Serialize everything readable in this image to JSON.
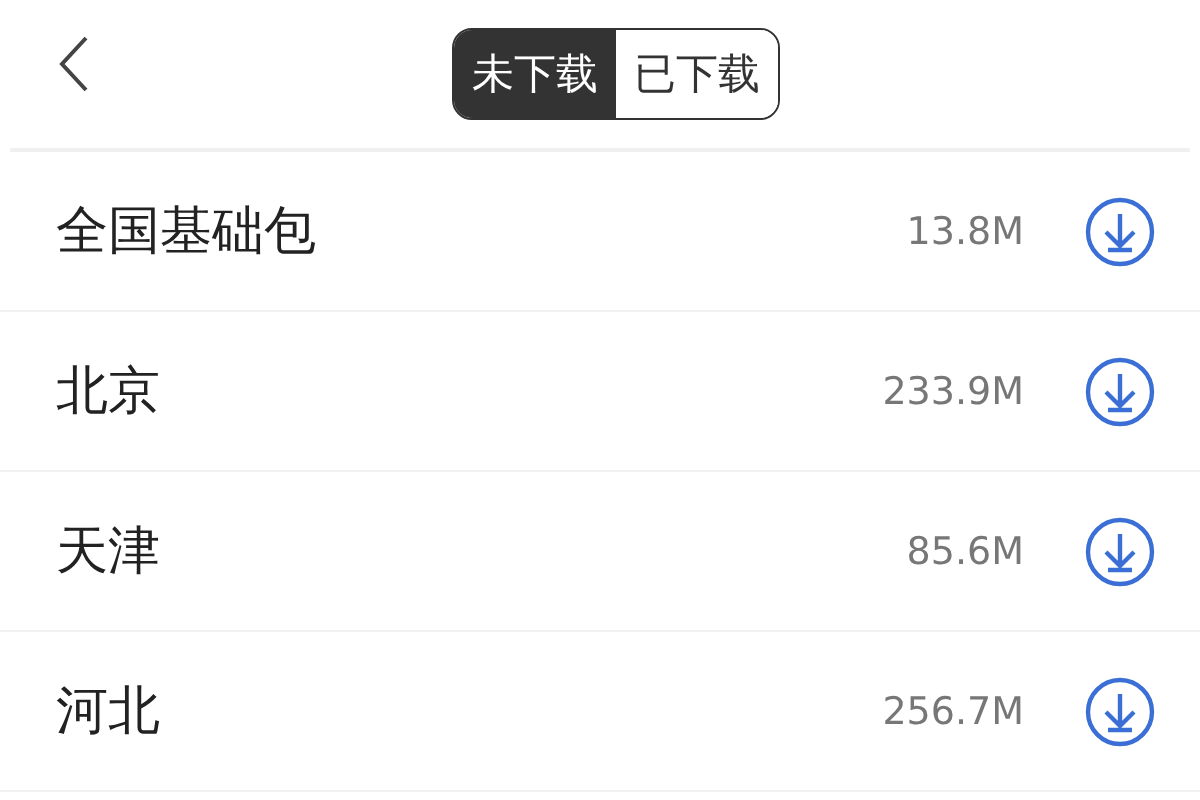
{
  "header": {
    "tabs": [
      {
        "label": "未下载",
        "selected": true
      },
      {
        "label": "已下载",
        "selected": false
      }
    ]
  },
  "items": [
    {
      "name": "全国基础包",
      "size": "13.8M"
    },
    {
      "name": "北京",
      "size": "233.9M"
    },
    {
      "name": "天津",
      "size": "85.6M"
    },
    {
      "name": "河北",
      "size": "256.7M"
    }
  ]
}
